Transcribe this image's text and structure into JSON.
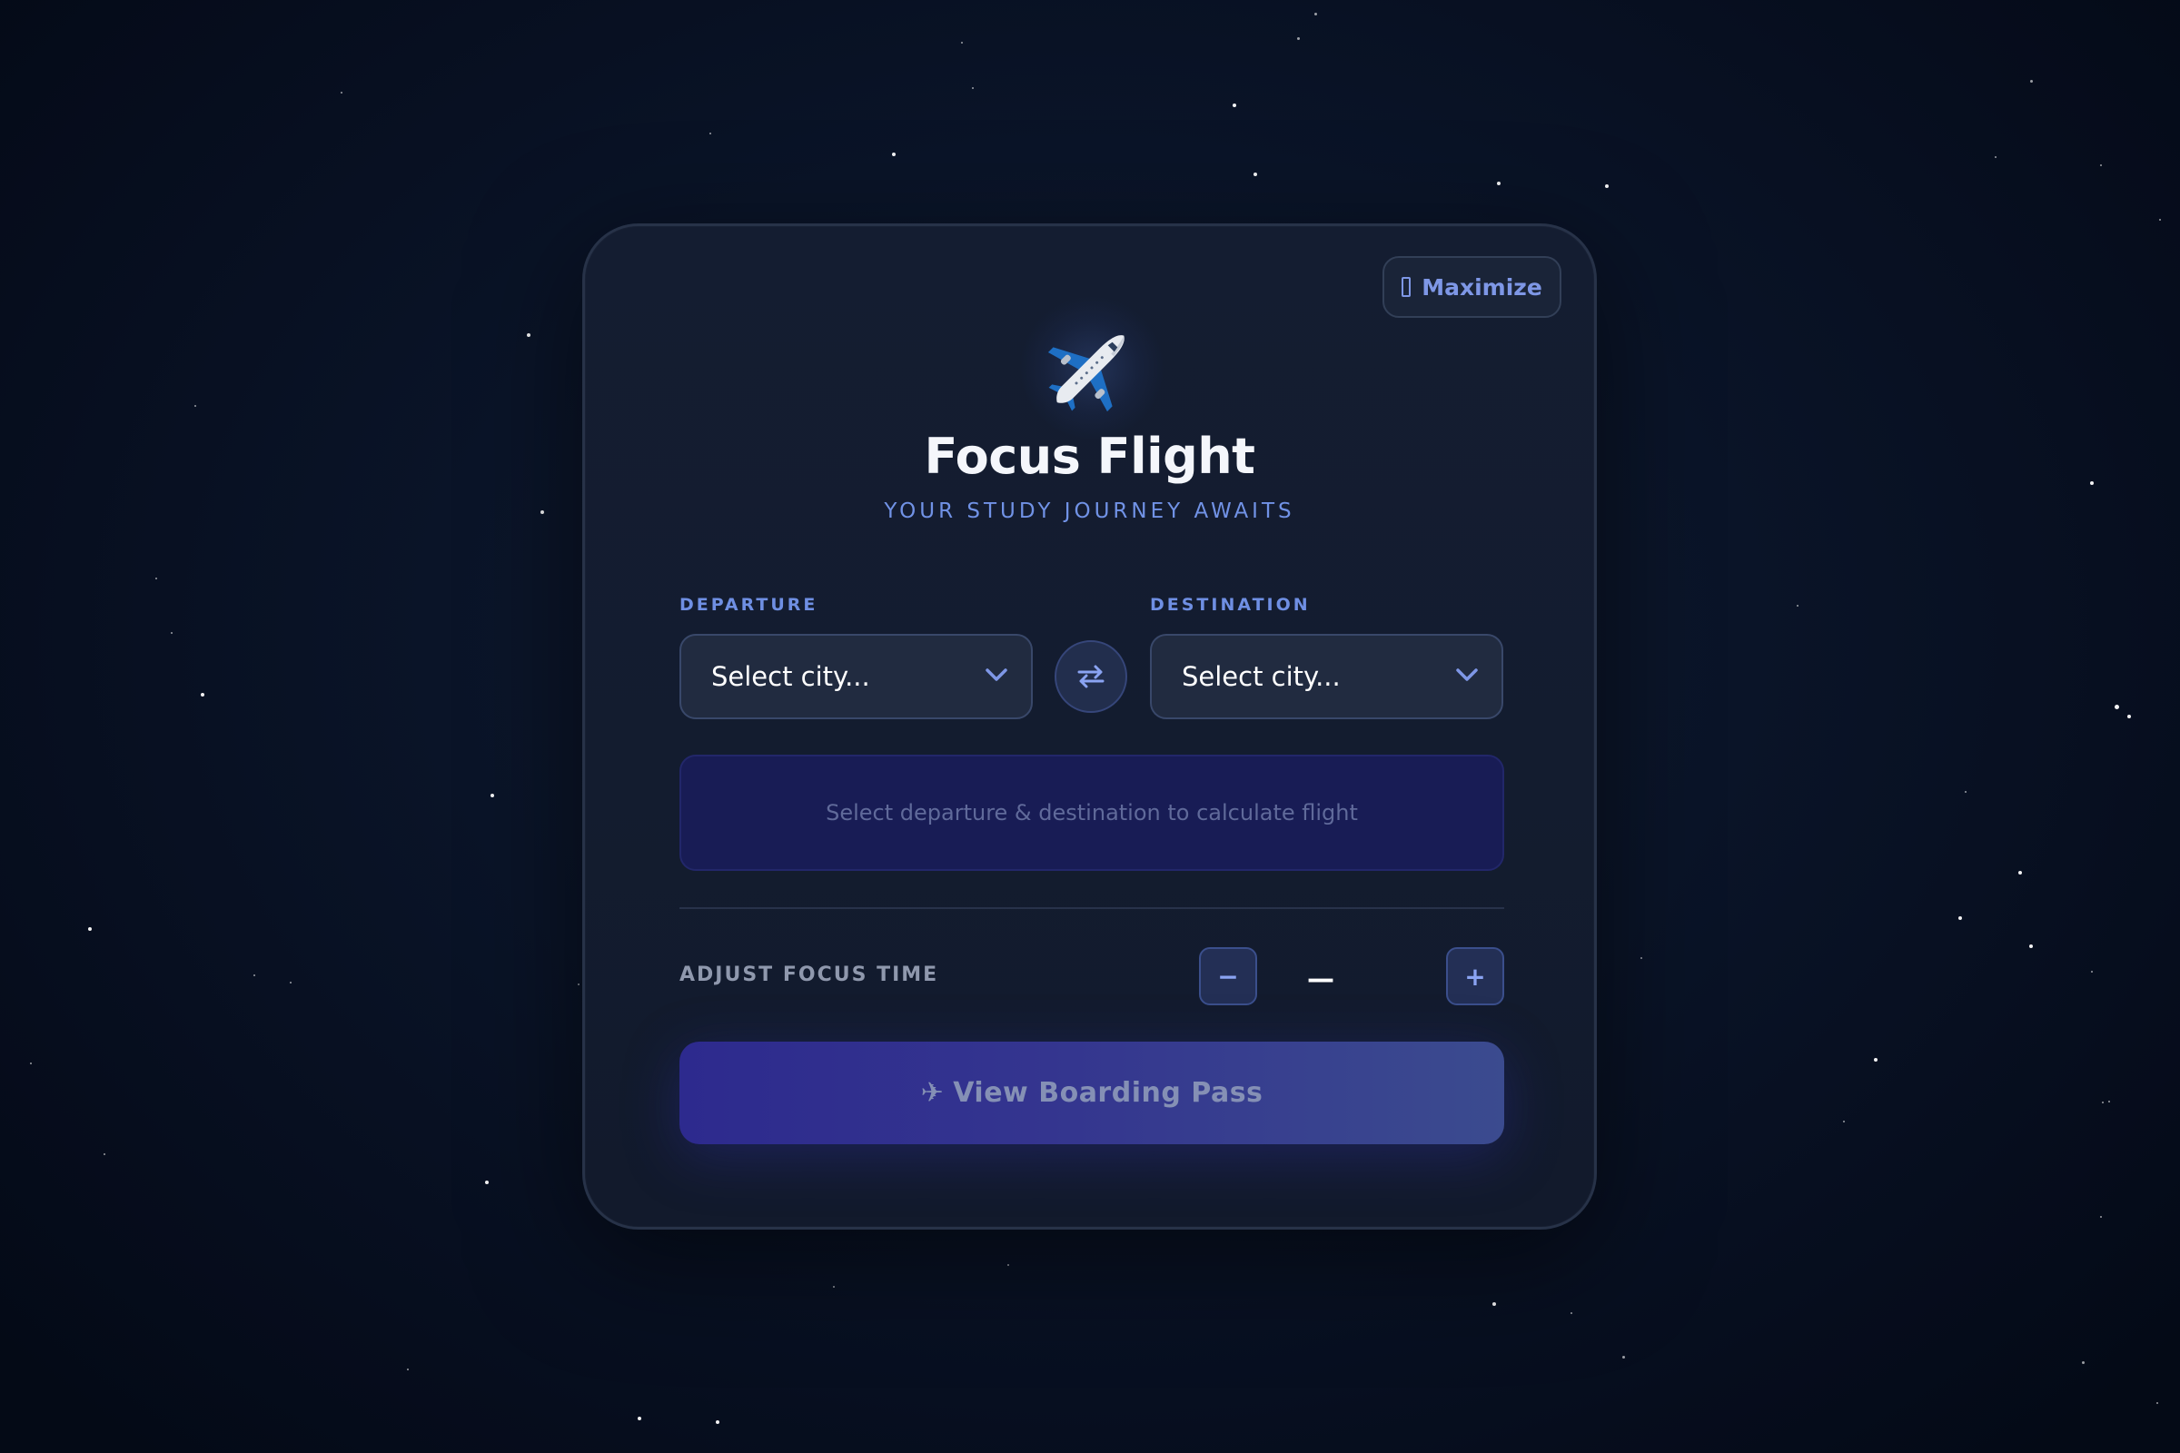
{
  "app": {
    "title": "Focus Flight",
    "subtitle": "YOUR STUDY JOURNEY AWAITS",
    "maximize_label": "Maximize",
    "plane_icon": "airplane-emoji"
  },
  "route": {
    "departure_label": "DEPARTURE",
    "departure_value": "Select city...",
    "destination_label": "DESTINATION",
    "destination_value": "Select city...",
    "swap_icon": "swap-arrows-icon"
  },
  "info": {
    "message": "Select departure & destination to calculate flight"
  },
  "focus_time": {
    "label": "ADJUST FOCUS TIME",
    "decrement_label": "−",
    "increment_label": "+",
    "value": "—"
  },
  "boarding": {
    "icon": "✈",
    "label": "View Boarding Pass"
  },
  "colors": {
    "background": "#0a1428",
    "card": "#141d31",
    "accent": "#7192e6",
    "info_box": "#181c55",
    "button_start": "#2d2a8e",
    "button_end": "#3b4b8f"
  }
}
